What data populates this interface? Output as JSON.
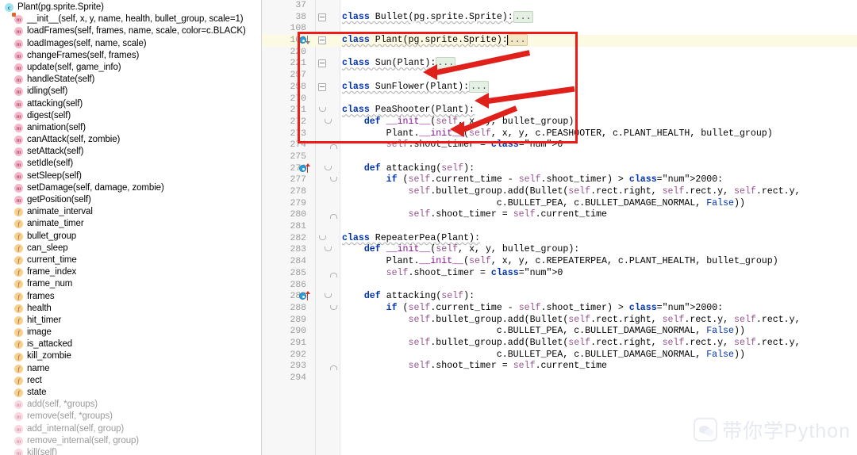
{
  "sidebar": {
    "title": "Plant(pg.sprite.Sprite)",
    "items": [
      {
        "kind": "class",
        "label": "Plant(pg.sprite.Sprite)",
        "icon": "class-icon",
        "level": 0,
        "dim": false,
        "override": false
      },
      {
        "kind": "method",
        "label": "__init__(self, x, y, name, health, bullet_group, scale=1)",
        "icon": "method-icon",
        "level": 1,
        "dim": false,
        "override": true
      },
      {
        "kind": "method",
        "label": "loadFrames(self, frames, name, scale, color=c.BLACK)",
        "icon": "method-icon",
        "level": 1,
        "dim": false,
        "override": false
      },
      {
        "kind": "method",
        "label": "loadImages(self, name, scale)",
        "icon": "method-icon",
        "level": 1,
        "dim": false,
        "override": false
      },
      {
        "kind": "method",
        "label": "changeFrames(self, frames)",
        "icon": "method-icon",
        "level": 1,
        "dim": false,
        "override": false
      },
      {
        "kind": "method",
        "label": "update(self, game_info)",
        "icon": "method-icon",
        "level": 1,
        "dim": false,
        "override": false
      },
      {
        "kind": "method",
        "label": "handleState(self)",
        "icon": "method-icon",
        "level": 1,
        "dim": false,
        "override": false
      },
      {
        "kind": "method",
        "label": "idling(self)",
        "icon": "method-icon",
        "level": 1,
        "dim": false,
        "override": false
      },
      {
        "kind": "method",
        "label": "attacking(self)",
        "icon": "method-icon",
        "level": 1,
        "dim": false,
        "override": false
      },
      {
        "kind": "method",
        "label": "digest(self)",
        "icon": "method-icon",
        "level": 1,
        "dim": false,
        "override": false
      },
      {
        "kind": "method",
        "label": "animation(self)",
        "icon": "method-icon",
        "level": 1,
        "dim": false,
        "override": false
      },
      {
        "kind": "method",
        "label": "canAttack(self, zombie)",
        "icon": "method-icon",
        "level": 1,
        "dim": false,
        "override": false
      },
      {
        "kind": "method",
        "label": "setAttack(self)",
        "icon": "method-icon",
        "level": 1,
        "dim": false,
        "override": false
      },
      {
        "kind": "method",
        "label": "setIdle(self)",
        "icon": "method-icon",
        "level": 1,
        "dim": false,
        "override": false
      },
      {
        "kind": "method",
        "label": "setSleep(self)",
        "icon": "method-icon",
        "level": 1,
        "dim": false,
        "override": false
      },
      {
        "kind": "method",
        "label": "setDamage(self, damage, zombie)",
        "icon": "method-icon",
        "level": 1,
        "dim": false,
        "override": false
      },
      {
        "kind": "method",
        "label": "getPosition(self)",
        "icon": "method-icon",
        "level": 1,
        "dim": false,
        "override": false
      },
      {
        "kind": "field",
        "label": "animate_interval",
        "icon": "field-icon",
        "level": 1,
        "dim": false,
        "override": false
      },
      {
        "kind": "field",
        "label": "animate_timer",
        "icon": "field-icon",
        "level": 1,
        "dim": false,
        "override": false
      },
      {
        "kind": "field",
        "label": "bullet_group",
        "icon": "field-icon",
        "level": 1,
        "dim": false,
        "override": false
      },
      {
        "kind": "field",
        "label": "can_sleep",
        "icon": "field-icon",
        "level": 1,
        "dim": false,
        "override": false
      },
      {
        "kind": "field",
        "label": "current_time",
        "icon": "field-icon",
        "level": 1,
        "dim": false,
        "override": false
      },
      {
        "kind": "field",
        "label": "frame_index",
        "icon": "field-icon",
        "level": 1,
        "dim": false,
        "override": false
      },
      {
        "kind": "field",
        "label": "frame_num",
        "icon": "field-icon",
        "level": 1,
        "dim": false,
        "override": false
      },
      {
        "kind": "field",
        "label": "frames",
        "icon": "field-icon",
        "level": 1,
        "dim": false,
        "override": false
      },
      {
        "kind": "field",
        "label": "health",
        "icon": "field-icon",
        "level": 1,
        "dim": false,
        "override": false
      },
      {
        "kind": "field",
        "label": "hit_timer",
        "icon": "field-icon",
        "level": 1,
        "dim": false,
        "override": false
      },
      {
        "kind": "field",
        "label": "image",
        "icon": "field-icon",
        "level": 1,
        "dim": false,
        "override": false
      },
      {
        "kind": "field",
        "label": "is_attacked",
        "icon": "field-icon",
        "level": 1,
        "dim": false,
        "override": false
      },
      {
        "kind": "field",
        "label": "kill_zombie",
        "icon": "field-icon",
        "level": 1,
        "dim": false,
        "override": false
      },
      {
        "kind": "field",
        "label": "name",
        "icon": "field-icon",
        "level": 1,
        "dim": false,
        "override": false
      },
      {
        "kind": "field",
        "label": "rect",
        "icon": "field-icon",
        "level": 1,
        "dim": false,
        "override": false
      },
      {
        "kind": "field",
        "label": "state",
        "icon": "field-icon",
        "level": 1,
        "dim": false,
        "override": false
      },
      {
        "kind": "method",
        "label": "add(self, *groups)",
        "icon": "method-icon",
        "level": 1,
        "dim": true,
        "override": false
      },
      {
        "kind": "method",
        "label": "remove(self, *groups)",
        "icon": "method-icon",
        "level": 1,
        "dim": true,
        "override": false
      },
      {
        "kind": "method",
        "label": "add_internal(self, group)",
        "icon": "method-icon",
        "level": 1,
        "dim": true,
        "override": false
      },
      {
        "kind": "method",
        "label": "remove_internal(self, group)",
        "icon": "method-icon",
        "level": 1,
        "dim": true,
        "override": false
      },
      {
        "kind": "method",
        "label": "kill(self)",
        "icon": "method-icon",
        "level": 1,
        "dim": true,
        "override": false
      }
    ]
  },
  "editor": {
    "lines": [
      {
        "num": "37",
        "text": ""
      },
      {
        "num": "38",
        "text": "class Bullet(pg.sprite.Sprite):..."
      },
      {
        "num": "108",
        "text": ""
      },
      {
        "num": "109",
        "text": "class Plant(pg.sprite.Sprite):..."
      },
      {
        "num": "220",
        "text": ""
      },
      {
        "num": "221",
        "text": "class Sun(Plant):..."
      },
      {
        "num": "257",
        "text": ""
      },
      {
        "num": "258",
        "text": "class SunFlower(Plant):..."
      },
      {
        "num": "270",
        "text": ""
      },
      {
        "num": "271",
        "text": "class PeaShooter(Plant):"
      },
      {
        "num": "272",
        "text": "    def __init__(self, x, y, bullet_group):"
      },
      {
        "num": "273",
        "text": "        Plant.__init__(self, x, y, c.PEASHOOTER, c.PLANT_HEALTH, bullet_group)"
      },
      {
        "num": "274",
        "text": "        self.shoot_timer = 0"
      },
      {
        "num": "275",
        "text": ""
      },
      {
        "num": "276",
        "text": "    def attacking(self):"
      },
      {
        "num": "277",
        "text": "        if (self.current_time - self.shoot_timer) > 2000:"
      },
      {
        "num": "278",
        "text": "            self.bullet_group.add(Bullet(self.rect.right, self.rect.y, self.rect.y,"
      },
      {
        "num": "279",
        "text": "                            c.BULLET_PEA, c.BULLET_DAMAGE_NORMAL, False))"
      },
      {
        "num": "280",
        "text": "            self.shoot_timer = self.current_time"
      },
      {
        "num": "281",
        "text": ""
      },
      {
        "num": "282",
        "text": "class RepeaterPea(Plant):"
      },
      {
        "num": "283",
        "text": "    def __init__(self, x, y, bullet_group):"
      },
      {
        "num": "284",
        "text": "        Plant.__init__(self, x, y, c.REPEATERPEA, c.PLANT_HEALTH, bullet_group)"
      },
      {
        "num": "285",
        "text": "        self.shoot_timer = 0"
      },
      {
        "num": "286",
        "text": ""
      },
      {
        "num": "287",
        "text": "    def attacking(self):"
      },
      {
        "num": "288",
        "text": "        if (self.current_time - self.shoot_timer) > 2000:"
      },
      {
        "num": "289",
        "text": "            self.bullet_group.add(Bullet(self.rect.right, self.rect.y, self.rect.y,"
      },
      {
        "num": "290",
        "text": "                            c.BULLET_PEA, c.BULLET_DAMAGE_NORMAL, False))"
      },
      {
        "num": "291",
        "text": "            self.bullet_group.add(Bullet(self.rect.right, self.rect.y, self.rect.y,"
      },
      {
        "num": "292",
        "text": "                            c.BULLET_PEA, c.BULLET_DAMAGE_NORMAL, False))"
      },
      {
        "num": "293",
        "text": "            self.shoot_timer = self.current_time"
      },
      {
        "num": "294",
        "text": ""
      }
    ]
  },
  "annotations": {
    "box_color": "#ee1b16",
    "arrow_color": "#e0201a",
    "arrow_count": 3,
    "arrow_targets": [
      "class Sun(Plant):",
      "class SunFlower(Plant):",
      "class PeaShooter(Plant):"
    ]
  },
  "watermark": {
    "text": "带你学Python",
    "logo": "wechat-logo"
  },
  "colors": {
    "keyword": "#0033b3",
    "number": "#1750eb",
    "self_param": "#94558d",
    "field": "#871094",
    "function": "#00627a",
    "fold_placeholder_bg": "#e3f0e3",
    "caret_row_bg": "#fdfae4",
    "gutter_bg": "#f7f7f7"
  }
}
